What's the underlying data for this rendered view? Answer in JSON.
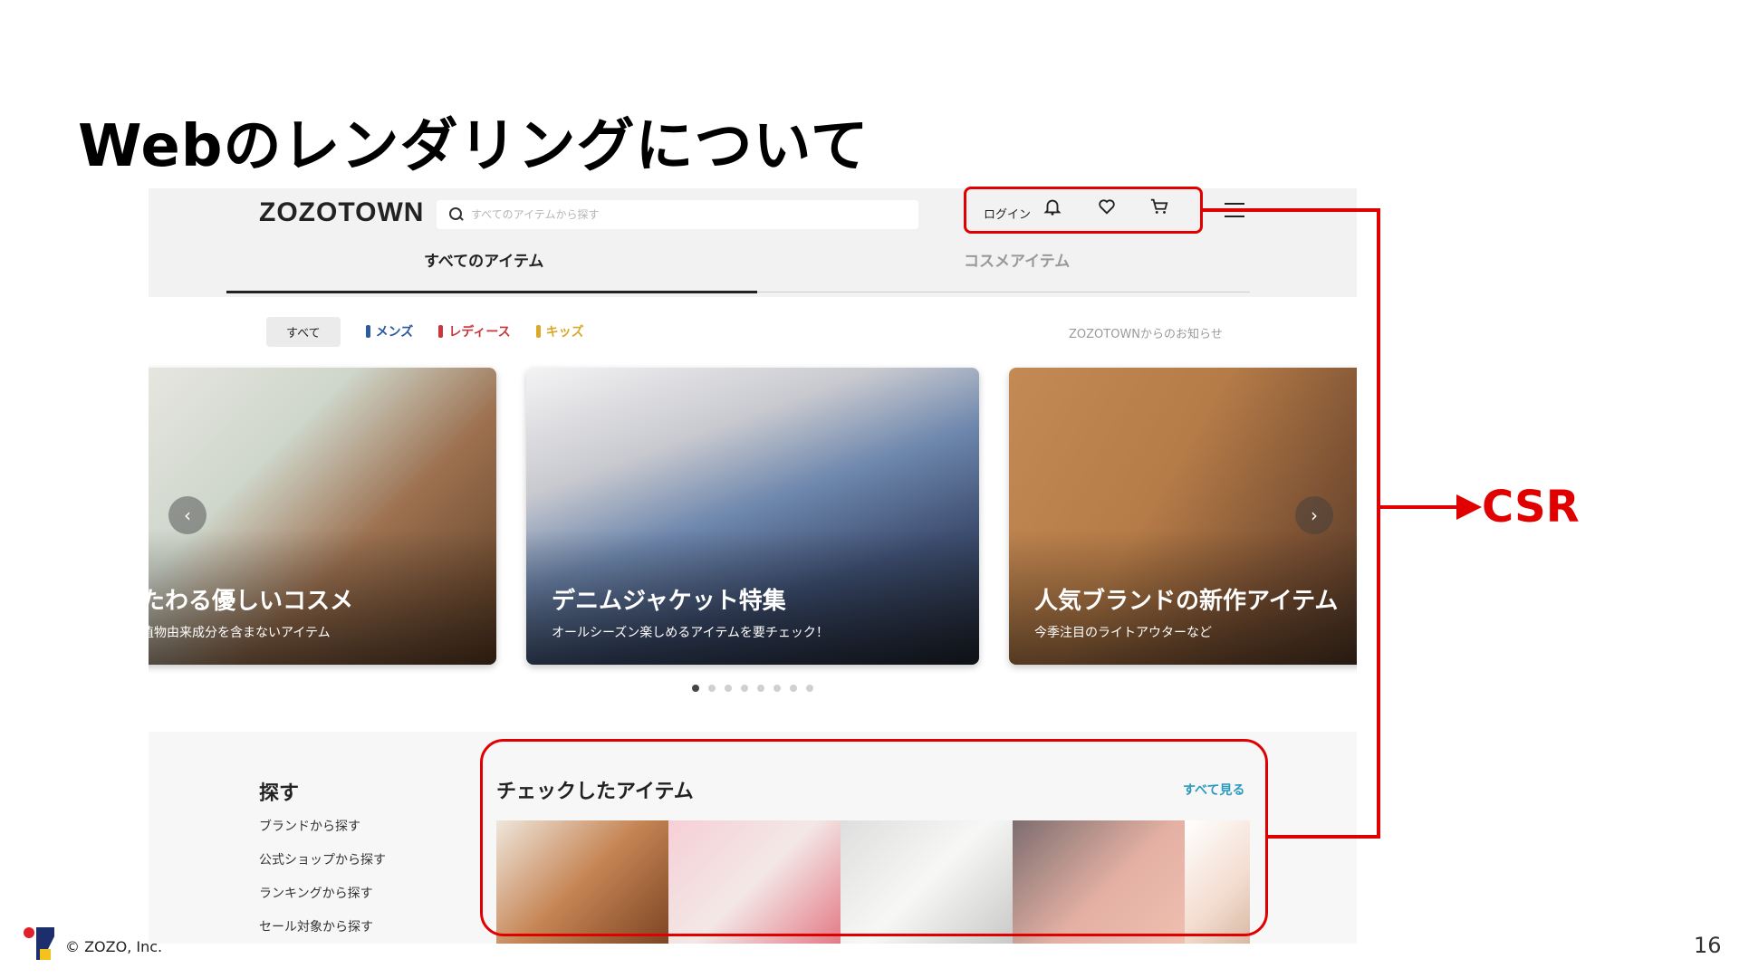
{
  "slide": {
    "title": "Webのレンダリングについて",
    "annotation_label": "CSR",
    "copyright": "© ZOZO, Inc.",
    "page_number": "16"
  },
  "colors": {
    "accent_red": "#e00000",
    "link_teal": "#2a9abf",
    "men": "#2b5a9e",
    "ladies": "#c8373c",
    "kids": "#d9a92a"
  },
  "header": {
    "logo": "ZOZOTOWN",
    "search_placeholder": "すべてのアイテムから探す",
    "login_label": "ログイン",
    "icons": [
      "bell-icon",
      "heart-icon",
      "cart-icon",
      "menu-icon"
    ]
  },
  "tabs": [
    {
      "label": "すべてのアイテム",
      "active": true
    },
    {
      "label": "コスメアイテム",
      "active": false
    }
  ],
  "filters": {
    "all": "すべて",
    "men": "メンズ",
    "ladies": "レディース",
    "kids": "キッズ",
    "notice_link": "ZOZOTOWNからのお知らせ"
  },
  "banners": [
    {
      "title": "たわる優しいコスメ",
      "subtitle": "植物由来成分を含まないアイテム"
    },
    {
      "title": "デニムジャケット特集",
      "subtitle": "オールシーズン楽しめるアイテムを要チェック！"
    },
    {
      "title": "人気ブランドの新作アイテム",
      "subtitle": "今季注目のライトアウターなど"
    }
  ],
  "carousel": {
    "total_dots": 8,
    "active_index": 0
  },
  "browse": {
    "title": "探す",
    "links": [
      "ブランドから探す",
      "公式ショップから探す",
      "ランキングから探す",
      "セール対象から探す"
    ]
  },
  "checked": {
    "title": "チェックしたアイテム",
    "see_all": "すべて見る"
  }
}
